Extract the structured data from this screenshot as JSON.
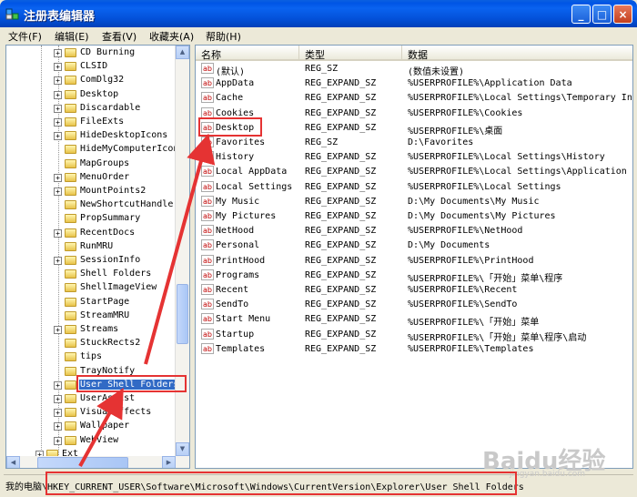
{
  "window": {
    "title": "注册表编辑器"
  },
  "menu": [
    "文件(F)",
    "编辑(E)",
    "查看(V)",
    "收藏夹(A)",
    "帮助(H)"
  ],
  "tree": {
    "items": [
      {
        "label": "CD Burning",
        "expandable": true
      },
      {
        "label": "CLSID",
        "expandable": true
      },
      {
        "label": "ComDlg32",
        "expandable": true
      },
      {
        "label": "Desktop",
        "expandable": true
      },
      {
        "label": "Discardable",
        "expandable": true
      },
      {
        "label": "FileExts",
        "expandable": true
      },
      {
        "label": "HideDesktopIcons",
        "expandable": true
      },
      {
        "label": "HideMyComputerIcon",
        "expandable": false
      },
      {
        "label": "MapGroups",
        "expandable": false
      },
      {
        "label": "MenuOrder",
        "expandable": true
      },
      {
        "label": "MountPoints2",
        "expandable": true
      },
      {
        "label": "NewShortcutHandler",
        "expandable": false
      },
      {
        "label": "PropSummary",
        "expandable": false
      },
      {
        "label": "RecentDocs",
        "expandable": true
      },
      {
        "label": "RunMRU",
        "expandable": false
      },
      {
        "label": "SessionInfo",
        "expandable": true
      },
      {
        "label": "Shell Folders",
        "expandable": false
      },
      {
        "label": "ShellImageView",
        "expandable": false
      },
      {
        "label": "StartPage",
        "expandable": false
      },
      {
        "label": "StreamMRU",
        "expandable": false
      },
      {
        "label": "Streams",
        "expandable": true
      },
      {
        "label": "StuckRects2",
        "expandable": false
      },
      {
        "label": "tips",
        "expandable": false
      },
      {
        "label": "TrayNotify",
        "expandable": false
      },
      {
        "label": "User Shell Folders",
        "expandable": true,
        "selected": true
      },
      {
        "label": "UserAssist",
        "expandable": true
      },
      {
        "label": "VisualEffects",
        "expandable": true
      },
      {
        "label": "Wallpaper",
        "expandable": true
      },
      {
        "label": "WebView",
        "expandable": true
      },
      {
        "label": "Ext",
        "expandable": true,
        "parent": true
      }
    ]
  },
  "list": {
    "headers": [
      "名称",
      "类型",
      "数据"
    ],
    "rows": [
      [
        "(默认)",
        "REG_SZ",
        "(数值未设置)"
      ],
      [
        "AppData",
        "REG_EXPAND_SZ",
        "%USERPROFILE%\\Application Data"
      ],
      [
        "Cache",
        "REG_EXPAND_SZ",
        "%USERPROFILE%\\Local Settings\\Temporary Inte"
      ],
      [
        "Cookies",
        "REG_EXPAND_SZ",
        "%USERPROFILE%\\Cookies"
      ],
      [
        "Desktop",
        "REG_EXPAND_SZ",
        "%USERPROFILE%\\桌面"
      ],
      [
        "Favorites",
        "REG_SZ",
        "D:\\Favorites"
      ],
      [
        "History",
        "REG_EXPAND_SZ",
        "%USERPROFILE%\\Local Settings\\History"
      ],
      [
        "Local AppData",
        "REG_EXPAND_SZ",
        "%USERPROFILE%\\Local Settings\\Application Da"
      ],
      [
        "Local Settings",
        "REG_EXPAND_SZ",
        "%USERPROFILE%\\Local Settings"
      ],
      [
        "My Music",
        "REG_EXPAND_SZ",
        "D:\\My Documents\\My Music"
      ],
      [
        "My Pictures",
        "REG_EXPAND_SZ",
        "D:\\My Documents\\My Pictures"
      ],
      [
        "NetHood",
        "REG_EXPAND_SZ",
        "%USERPROFILE%\\NetHood"
      ],
      [
        "Personal",
        "REG_EXPAND_SZ",
        "D:\\My Documents"
      ],
      [
        "PrintHood",
        "REG_EXPAND_SZ",
        "%USERPROFILE%\\PrintHood"
      ],
      [
        "Programs",
        "REG_EXPAND_SZ",
        "%USERPROFILE%\\「开始」菜单\\程序"
      ],
      [
        "Recent",
        "REG_EXPAND_SZ",
        "%USERPROFILE%\\Recent"
      ],
      [
        "SendTo",
        "REG_EXPAND_SZ",
        "%USERPROFILE%\\SendTo"
      ],
      [
        "Start Menu",
        "REG_EXPAND_SZ",
        "%USERPROFILE%\\「开始」菜单"
      ],
      [
        "Startup",
        "REG_EXPAND_SZ",
        "%USERPROFILE%\\「开始」菜单\\程序\\启动"
      ],
      [
        "Templates",
        "REG_EXPAND_SZ",
        "%USERPROFILE%\\Templates"
      ]
    ]
  },
  "status": {
    "path": "我的电脑\\HKEY_CURRENT_USER\\Software\\Microsoft\\Windows\\CurrentVersion\\Explorer\\User Shell Folders"
  },
  "watermark": {
    "text": "Baidu经验",
    "sub": "jingyan.baidu.com"
  },
  "colors": {
    "highlight": "#e53333",
    "selection": "#316ac5",
    "titlebar": "#0a5fe0"
  }
}
